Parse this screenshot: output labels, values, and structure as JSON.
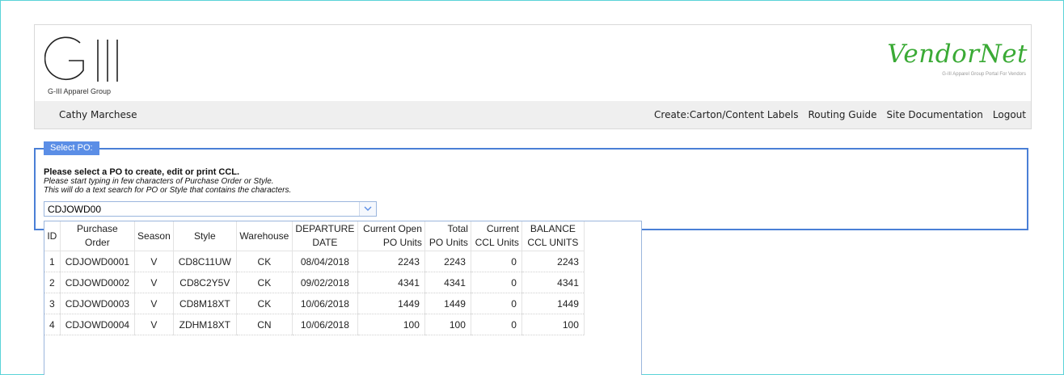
{
  "header": {
    "logo_text": "G-III",
    "logo_caption": "G-III Apparel Group",
    "brand_title": "VendorNet",
    "brand_subtitle": "G-III Apparel Group Portal For Vendors"
  },
  "nav": {
    "user": "Cathy Marchese",
    "links": [
      "Create:Carton/Content Labels",
      "Routing Guide",
      "Site Documentation",
      "Logout"
    ]
  },
  "panel": {
    "legend": "Select PO:",
    "instruction_bold": "Please select a PO to create, edit or print CCL.",
    "instruction_line1": "Please start typing in few characters of Purchase Order or Style.",
    "instruction_line2": "This will do a text search for PO or Style that contains the characters.",
    "search_value": "CDJOWD00"
  },
  "table": {
    "headers": [
      [
        "ID"
      ],
      [
        "Purchase",
        "Order"
      ],
      [
        "Season"
      ],
      [
        "Style"
      ],
      [
        "Warehouse"
      ],
      [
        "DEPARTURE",
        "DATE"
      ],
      [
        "Current Open",
        "PO Units"
      ],
      [
        "Total",
        "PO Units"
      ],
      [
        "Current",
        "CCL Units"
      ],
      [
        "BALANCE",
        "CCL UNITS"
      ]
    ],
    "rows": [
      [
        "1",
        "CDJOWD0001",
        "V",
        "CD8C11UW",
        "CK",
        "08/04/2018",
        "2243",
        "2243",
        "0",
        "2243"
      ],
      [
        "2",
        "CDJOWD0002",
        "V",
        "CD8C2Y5V",
        "CK",
        "09/02/2018",
        "4341",
        "4341",
        "0",
        "4341"
      ],
      [
        "3",
        "CDJOWD0003",
        "V",
        "CD8M18XT",
        "CK",
        "10/06/2018",
        "1449",
        "1449",
        "0",
        "1449"
      ],
      [
        "4",
        "CDJOWD0004",
        "V",
        "ZDHM18XT",
        "CN",
        "10/06/2018",
        "100",
        "100",
        "0",
        "100"
      ]
    ]
  },
  "colors": {
    "brand_green": "#3aaa35",
    "panel_border": "#4a7fd6",
    "legend_bg": "#5b8ee6",
    "page_outline": "#5bd3d8"
  }
}
